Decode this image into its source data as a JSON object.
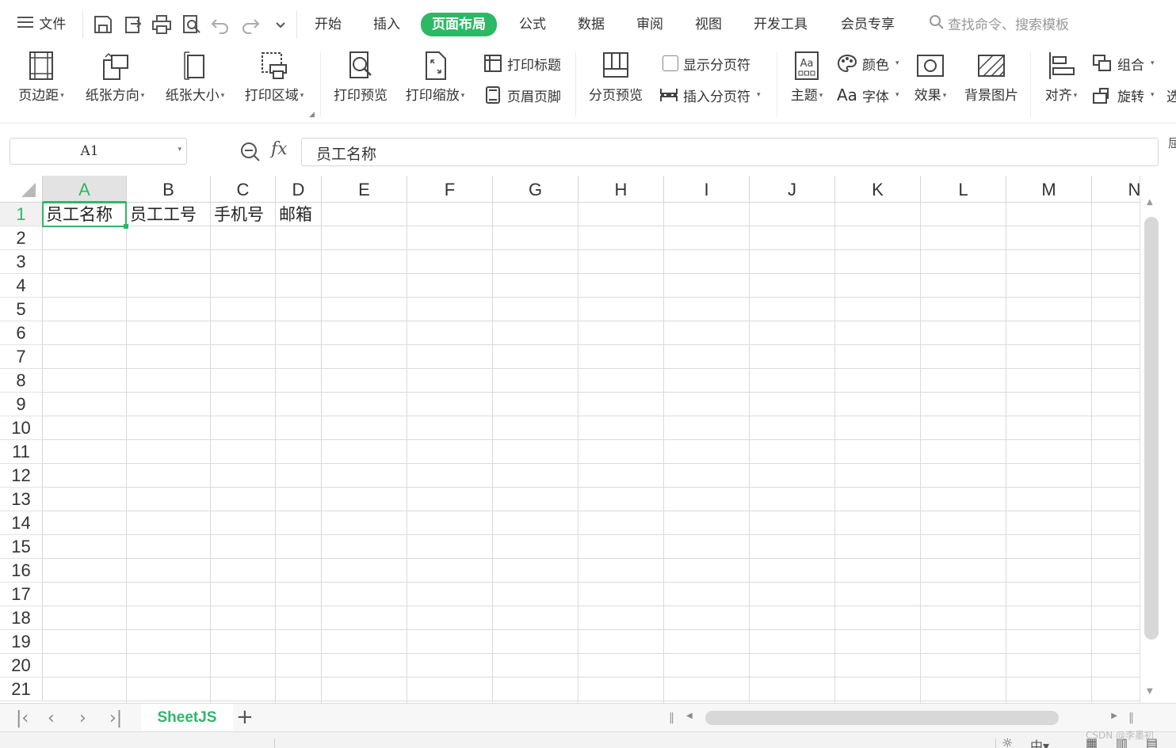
{
  "menubar": {
    "file_label": "文件",
    "tabs": [
      "开始",
      "插入",
      "页面布局",
      "公式",
      "数据",
      "审阅",
      "视图",
      "开发工具",
      "会员专享"
    ],
    "active_tab": "页面布局",
    "search_placeholder": "查找命令、搜索模板"
  },
  "ribbon": {
    "margins": "页边距",
    "orientation": "纸张方向",
    "size": "纸张大小",
    "print_area": "打印区域",
    "print_preview": "打印预览",
    "print_scale": "打印缩放",
    "print_titles": "打印标题",
    "header_footer": "页眉页脚",
    "page_break_preview": "分页预览",
    "show_page_breaks": "显示分页符",
    "insert_page_break": "插入分页符",
    "theme": "主题",
    "colors": "颜色",
    "fonts": "字体",
    "fonts_prefix": "Aa",
    "effects": "效果",
    "background": "背景图片",
    "align": "对齐",
    "group": "组合",
    "rotate": "旋转",
    "cut_off": "选"
  },
  "formula_bar": {
    "name_box": "A1",
    "fx": "fx",
    "value": "员工名称"
  },
  "grid": {
    "columns": [
      "A",
      "B",
      "C",
      "D",
      "E",
      "F",
      "G",
      "H",
      "I",
      "J",
      "K",
      "L",
      "M",
      "N"
    ],
    "rows": [
      "1",
      "2",
      "3",
      "4",
      "5",
      "6",
      "7",
      "8",
      "9",
      "10",
      "11",
      "12",
      "13",
      "14",
      "15",
      "16",
      "17",
      "18",
      "19",
      "20",
      "21"
    ],
    "row1": [
      "员工名称",
      "员工工号",
      "手机号",
      "邮箱"
    ]
  },
  "sheets": {
    "tabs": [
      "SheetJS"
    ],
    "add": "+"
  },
  "watermark": "CSDN @李墨初",
  "colors": {
    "accent": "#2db866"
  }
}
